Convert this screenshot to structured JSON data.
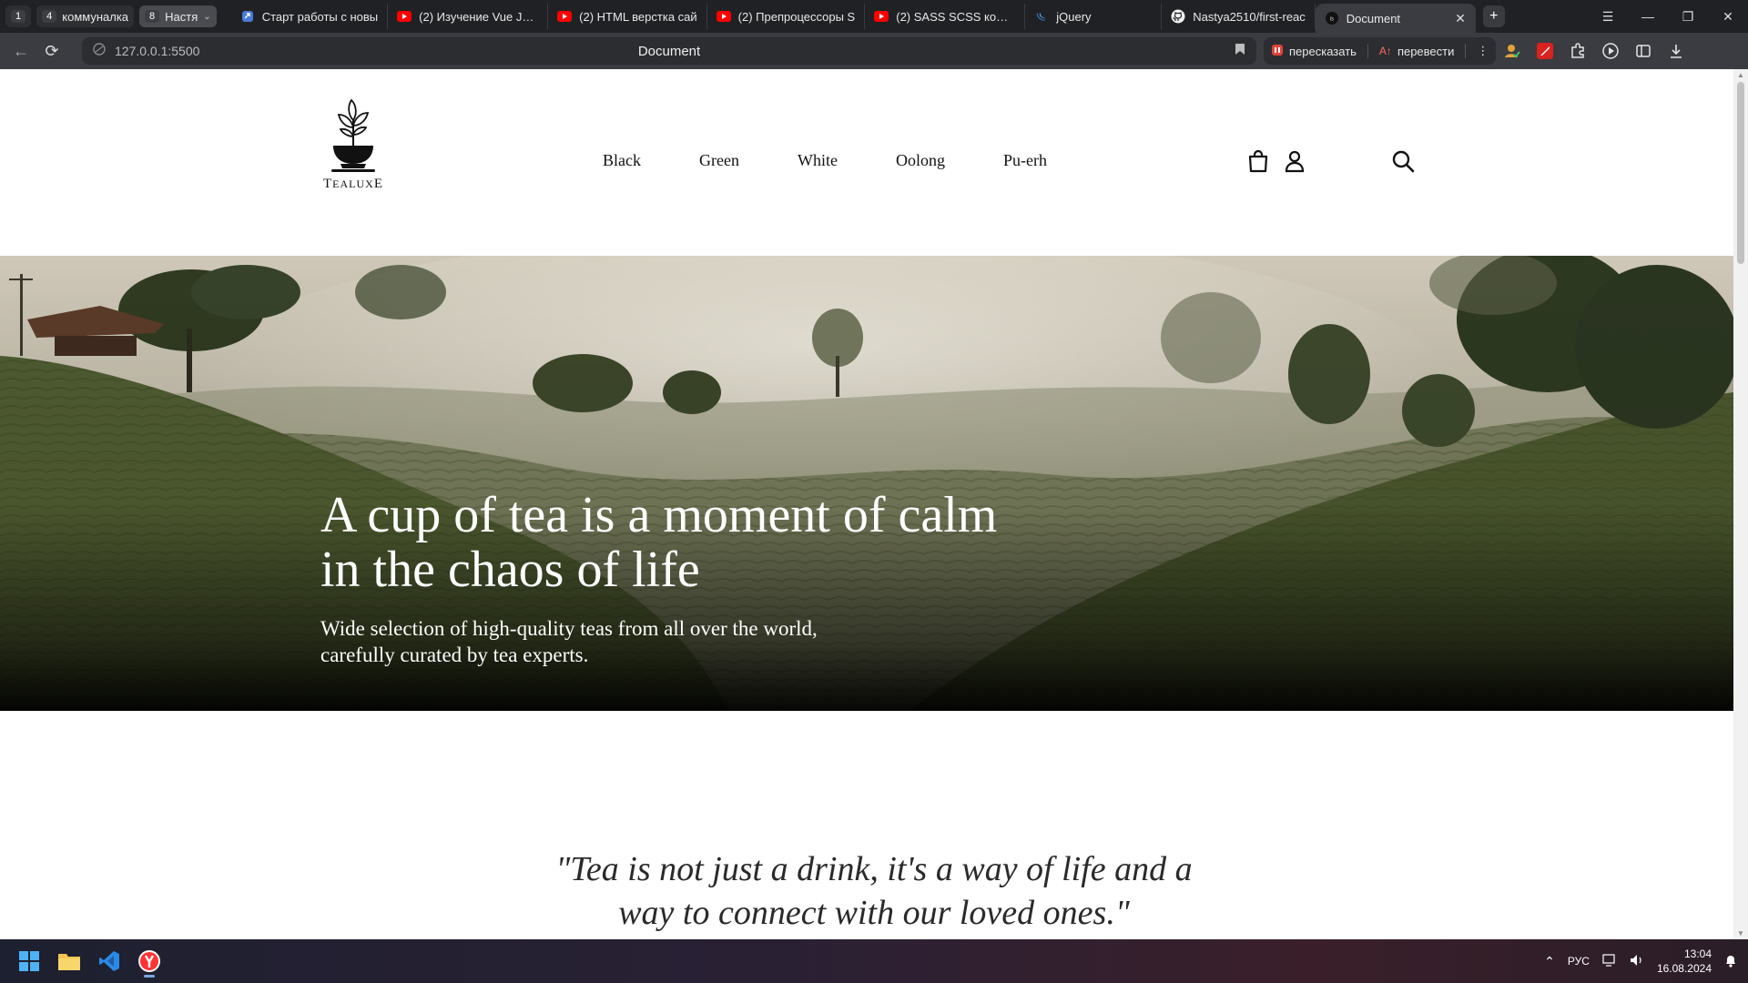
{
  "browser": {
    "tab_groups": [
      {
        "count": "1",
        "label": ""
      },
      {
        "count": "4",
        "label": "коммуналка"
      },
      {
        "count": "8",
        "label": "Настя"
      }
    ],
    "tabs": [
      {
        "icon": "link-icon",
        "label": "Старт работы с новы"
      },
      {
        "icon": "youtube-icon",
        "label": "(2) Изучение Vue JS с"
      },
      {
        "icon": "youtube-icon",
        "label": "(2) HTML верстка сай"
      },
      {
        "icon": "youtube-icon",
        "label": "(2) Препроцессоры S"
      },
      {
        "icon": "youtube-icon",
        "label": "(2) SASS SCSS компи"
      },
      {
        "icon": "jquery-icon",
        "label": "jQuery"
      },
      {
        "icon": "github-icon",
        "label": "Nastya2510/first-reac"
      },
      {
        "icon": "live-server-icon",
        "label": "Document",
        "active": true
      }
    ],
    "address": {
      "url": "127.0.0.1:5500",
      "page_title": "Document"
    },
    "actions": {
      "summarize": "пересказать",
      "translate": "перевести"
    }
  },
  "site": {
    "logo": {
      "text_large": "T",
      "text_small": "EALUX",
      "text_end": "E"
    },
    "nav": [
      "Black",
      "Green",
      "White",
      "Oolong",
      "Pu-erh"
    ],
    "hero": {
      "title_line1": "A cup of tea is a moment of calm",
      "title_line2": "in the chaos of life",
      "subtitle_line1": "Wide selection of high-quality teas from all over the world,",
      "subtitle_line2": "carefully curated by tea experts."
    },
    "quote": {
      "line1": "\"Tea is not just a drink, it's a way of life and a",
      "line2": "way to connect with our loved ones.\""
    }
  },
  "taskbar": {
    "language": "РУС",
    "time": "13:04",
    "date": "16.08.2024"
  },
  "colors": {
    "browser_bg": "#202124",
    "toolbar_bg": "#3b3c41",
    "page_bg": "#ffffff",
    "hero_text": "#ffffff",
    "taskbar_accent": "#7aa7e0"
  }
}
